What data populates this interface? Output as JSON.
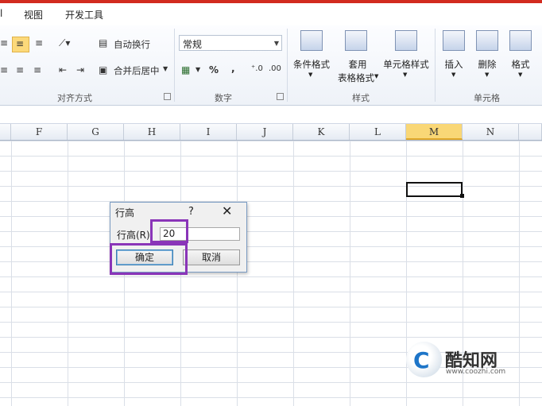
{
  "menu": {
    "partial": "l",
    "view": "视图",
    "developer": "开发工具"
  },
  "ribbon": {
    "alignment_group": "对齐方式",
    "wrap_text": "自动换行",
    "merge_center": "合并后居中",
    "number_group": "数字",
    "number_format": "常规",
    "percent": "%",
    "comma": ",",
    "styles_group": "样式",
    "conditional_format": "条件格式",
    "table_format_line1": "套用",
    "table_format_line2": "表格格式",
    "cell_styles": "单元格样式",
    "cells_group": "单元格",
    "insert": "插入",
    "delete": "删除",
    "format": "格式"
  },
  "columns": [
    "F",
    "G",
    "H",
    "I",
    "J",
    "K",
    "L",
    "M",
    "N"
  ],
  "selected_column": "M",
  "dialog": {
    "title": "行高",
    "help": "?",
    "close": "✕",
    "label": "行高(R):",
    "value": "20",
    "ok": "确定",
    "cancel": "取消"
  },
  "watermark": {
    "name": "酷知网",
    "url": "www.coozhi.com"
  },
  "colors": {
    "highlight": "#8a35b8",
    "topbar": "#d22b1f",
    "selected_header": "#f9d776"
  }
}
